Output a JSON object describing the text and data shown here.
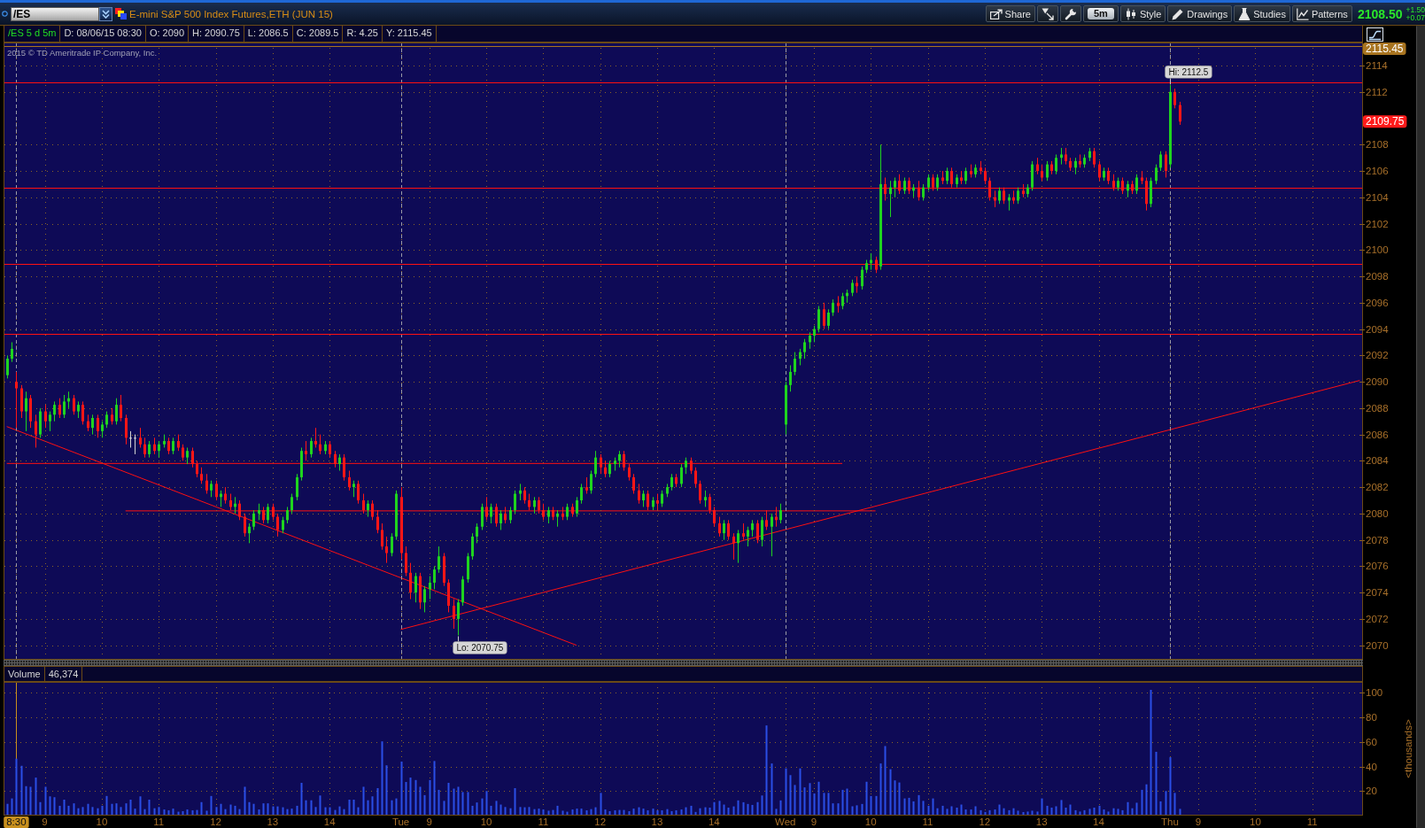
{
  "title_bar": {
    "symbol": "/ES",
    "description": "E-mini S&P 500 Index Futures,ETH (JUN 15)",
    "toolbar": [
      {
        "kind": "share",
        "label": "Share"
      },
      {
        "kind": "arrow"
      },
      {
        "kind": "wrench"
      },
      {
        "kind": "period",
        "label": "5m"
      },
      {
        "kind": "style",
        "label": "Style"
      },
      {
        "kind": "drawings",
        "label": "Drawings"
      },
      {
        "kind": "studies",
        "label": "Studies"
      },
      {
        "kind": "patterns",
        "label": "Patterns"
      }
    ],
    "last_price": "2108.50",
    "net_change": "+1.50",
    "percent_change": "+0.07"
  },
  "price_pane": {
    "study": "/ES 5 d 5m",
    "readouts": [
      "D: 08/06/15 08:30",
      "O: 2090",
      "H: 2090.75",
      "L: 2086.5",
      "C: 2089.5",
      "R: 4.25",
      "Y: 2115.45"
    ],
    "copyright": "2015 © TD Ameritrade IP Company, Inc.",
    "chart_data": [
      {
        "type": "candlestick",
        "ylim": [
          2068.9,
          2115.75
        ],
        "yticks": [
          2070,
          2072,
          2074,
          2076,
          2078,
          2080,
          2082,
          2084,
          2086,
          2088,
          2090,
          2092,
          2094,
          2096,
          2098,
          2100,
          2102,
          2104,
          2106,
          2108,
          2112,
          2114
        ],
        "tick_labels": "y",
        "grid": true,
        "ohlc": [
          [
            2090.5,
            2092,
            2090.25,
            2091.75
          ],
          [
            2091.75,
            2093,
            2091.5,
            2092.5
          ],
          [
            2090,
            2090.75,
            2086.5,
            2089.5
          ],
          [
            2089.5,
            2089.75,
            2087.25,
            2087.75
          ],
          [
            2087.75,
            2089.25,
            2086.25,
            2088.75
          ],
          [
            2088.75,
            2089,
            2086.5,
            2087
          ],
          [
            2087,
            2087.5,
            2085,
            2086
          ],
          [
            2086,
            2088,
            2085.75,
            2087.75
          ],
          [
            2087.75,
            2088.25,
            2086.5,
            2087
          ],
          [
            2087,
            2087.75,
            2086.25,
            2087.5
          ],
          [
            2087.5,
            2088.5,
            2087,
            2088.25
          ],
          [
            2088.25,
            2088.75,
            2087.25,
            2087.5
          ],
          [
            2087.5,
            2089,
            2087.25,
            2088.5
          ],
          [
            2088.5,
            2089.25,
            2088,
            2088.75
          ],
          [
            2088.75,
            2089,
            2087.5,
            2087.75
          ],
          [
            2087.75,
            2088.5,
            2087.25,
            2088.25
          ],
          [
            2088.25,
            2088.5,
            2086.75,
            2087
          ],
          [
            2087,
            2087.5,
            2086.25,
            2086.5
          ],
          [
            2086.5,
            2087.5,
            2086,
            2087.25
          ],
          [
            2087.25,
            2087.5,
            2085.75,
            2086.25
          ],
          [
            2086.25,
            2087,
            2085.75,
            2086.75
          ],
          [
            2086.75,
            2087.75,
            2086.5,
            2087.5
          ],
          [
            2087.5,
            2088,
            2086.75,
            2087
          ],
          [
            2087,
            2088.75,
            2086.75,
            2088.25
          ],
          [
            2088.25,
            2089,
            2087,
            2087.25
          ],
          [
            2087.25,
            2087.5,
            2085.25,
            2085.75
          ],
          [
            2085.75,
            2086.25,
            2085,
            2085.75
          ],
          [
            2085.75,
            2086,
            2084.5,
            2085.75
          ],
          [
            2085.75,
            2086.5,
            2085,
            2085.25
          ],
          [
            2085.25,
            2085.75,
            2084.25,
            2084.5
          ],
          [
            2084.5,
            2085.5,
            2084.25,
            2085.25
          ],
          [
            2085.25,
            2085.75,
            2084.5,
            2084.75
          ],
          [
            2084.75,
            2085.5,
            2084.25,
            2085.25
          ],
          [
            2085.25,
            2086,
            2085,
            2085.5
          ],
          [
            2085.5,
            2085.75,
            2084.5,
            2084.75
          ],
          [
            2084.75,
            2085.75,
            2084.5,
            2085.5
          ],
          [
            2085.5,
            2086,
            2084.75,
            2085
          ],
          [
            2085,
            2085.25,
            2084,
            2084.25
          ],
          [
            2084.25,
            2085,
            2083.75,
            2084.75
          ],
          [
            2084.75,
            2085,
            2083.5,
            2083.75
          ],
          [
            2083.75,
            2084,
            2082.75,
            2083
          ],
          [
            2083,
            2083.5,
            2082.25,
            2082.5
          ],
          [
            2082.5,
            2083,
            2081.5,
            2081.75
          ],
          [
            2081.75,
            2082.5,
            2081.25,
            2082.25
          ],
          [
            2082.25,
            2082.5,
            2081,
            2081.25
          ],
          [
            2081.25,
            2081.75,
            2080.5,
            2081.5
          ],
          [
            2081.5,
            2082,
            2080.75,
            2081
          ],
          [
            2081,
            2081.5,
            2080.25,
            2080.5
          ],
          [
            2080.5,
            2081.25,
            2080,
            2080.75
          ],
          [
            2080.75,
            2081,
            2079.5,
            2079.75
          ],
          [
            2079.75,
            2080,
            2078.25,
            2078.5
          ],
          [
            2078.5,
            2079.25,
            2077.75,
            2079
          ],
          [
            2079,
            2080.25,
            2078.75,
            2080
          ],
          [
            2080,
            2080.75,
            2079.5,
            2080.25
          ],
          [
            2080.25,
            2080.5,
            2079.25,
            2079.5
          ],
          [
            2079.5,
            2080.75,
            2079.25,
            2080.5
          ],
          [
            2080.5,
            2080.75,
            2079.5,
            2079.75
          ],
          [
            2079.75,
            2080,
            2078.25,
            2078.75
          ],
          [
            2078.75,
            2079.75,
            2078.5,
            2079.5
          ],
          [
            2079.5,
            2080.5,
            2079.25,
            2080.25
          ],
          [
            2080.25,
            2081.5,
            2080,
            2081.25
          ],
          [
            2081.25,
            2083,
            2081,
            2082.75
          ],
          [
            2082.75,
            2085,
            2082.5,
            2084.75
          ],
          [
            2084.75,
            2085.5,
            2084,
            2084.5
          ],
          [
            2084.5,
            2085.75,
            2084.25,
            2085.5
          ],
          [
            2085.5,
            2086.5,
            2085,
            2085.25
          ],
          [
            2085.25,
            2086,
            2084.5,
            2084.75
          ],
          [
            2084.75,
            2085.5,
            2084.5,
            2085.25
          ],
          [
            2085.25,
            2085.5,
            2084.25,
            2084.5
          ],
          [
            2084.5,
            2084.75,
            2083.5,
            2083.75
          ],
          [
            2083.75,
            2084.5,
            2083.25,
            2084.25
          ],
          [
            2084.25,
            2084.5,
            2082.5,
            2082.75
          ],
          [
            2082.75,
            2083.25,
            2081.75,
            2082
          ],
          [
            2082,
            2082.5,
            2081.25,
            2082.25
          ],
          [
            2082.25,
            2082.5,
            2080.75,
            2081
          ],
          [
            2081,
            2081.5,
            2080,
            2080.25
          ],
          [
            2080.25,
            2081,
            2079.75,
            2080.75
          ],
          [
            2080.75,
            2081,
            2079.5,
            2079.75
          ],
          [
            2079.75,
            2080.25,
            2078.5,
            2078.75
          ],
          [
            2078.75,
            2079.25,
            2077.25,
            2077.5
          ],
          [
            2077.5,
            2078.25,
            2076.25,
            2077
          ],
          [
            2077,
            2078.5,
            2076.75,
            2078.25
          ],
          [
            2078.25,
            2081.75,
            2078,
            2081.5
          ],
          [
            2081.25,
            2082,
            2076.5,
            2077
          ],
          [
            2077,
            2077.5,
            2075.25,
            2075.5
          ],
          [
            2075.5,
            2076.25,
            2073.5,
            2074
          ],
          [
            2074,
            2075.5,
            2073.25,
            2075.25
          ],
          [
            2075.25,
            2075.5,
            2072.75,
            2073.25
          ],
          [
            2073.25,
            2074.5,
            2072.5,
            2074.25
          ],
          [
            2074.25,
            2075.25,
            2073.5,
            2074.75
          ],
          [
            2074.75,
            2076,
            2074.25,
            2075.75
          ],
          [
            2075.75,
            2077.5,
            2075.5,
            2076.75
          ],
          [
            2076.75,
            2077,
            2074.5,
            2074.75
          ],
          [
            2074.75,
            2075,
            2072.5,
            2073
          ],
          [
            2073,
            2073.5,
            2071.25,
            2072
          ],
          [
            2072,
            2073.5,
            2070.75,
            2073.25
          ],
          [
            2073.25,
            2075.25,
            2073,
            2075
          ],
          [
            2075,
            2077,
            2074.75,
            2076.75
          ],
          [
            2076.75,
            2078.5,
            2076.5,
            2078.25
          ],
          [
            2078.25,
            2079.25,
            2077.75,
            2079
          ],
          [
            2079,
            2080.75,
            2078.75,
            2080.5
          ],
          [
            2080.5,
            2081.25,
            2079.5,
            2079.75
          ],
          [
            2079.75,
            2080.75,
            2079.25,
            2080.5
          ],
          [
            2080.5,
            2080.75,
            2079,
            2079.25
          ],
          [
            2079.25,
            2080.25,
            2078.75,
            2080
          ],
          [
            2080,
            2080.5,
            2079.25,
            2079.5
          ],
          [
            2079.5,
            2080.5,
            2079.25,
            2080.25
          ],
          [
            2080.25,
            2081.75,
            2080,
            2081.5
          ],
          [
            2081.5,
            2082.25,
            2081,
            2081.75
          ],
          [
            2081.75,
            2082,
            2080.75,
            2081
          ],
          [
            2081,
            2081.5,
            2080.25,
            2080.5
          ],
          [
            2080.5,
            2081.25,
            2080,
            2081
          ],
          [
            2081,
            2081.25,
            2080,
            2080.25
          ],
          [
            2080.25,
            2080.75,
            2079.5,
            2079.75
          ],
          [
            2079.75,
            2080.5,
            2079.25,
            2080.25
          ],
          [
            2080.25,
            2080.5,
            2079.5,
            2079.75
          ],
          [
            2079.75,
            2080.25,
            2079,
            2080
          ],
          [
            2080,
            2080.5,
            2079.5,
            2079.75
          ],
          [
            2079.75,
            2080.75,
            2079.5,
            2080.5
          ],
          [
            2080.5,
            2080.75,
            2079.75,
            2080
          ],
          [
            2080,
            2081.25,
            2079.75,
            2081
          ],
          [
            2081,
            2082.25,
            2080.75,
            2082
          ],
          [
            2082,
            2082.75,
            2081.5,
            2081.75
          ],
          [
            2081.75,
            2083.25,
            2081.5,
            2083
          ],
          [
            2083,
            2084.75,
            2082.75,
            2084.25
          ],
          [
            2084.25,
            2084.5,
            2083,
            2083.5
          ],
          [
            2083.5,
            2084,
            2082.75,
            2083
          ],
          [
            2083,
            2084,
            2082.75,
            2083.75
          ],
          [
            2083.75,
            2084.25,
            2083.25,
            2084
          ],
          [
            2084,
            2084.75,
            2083.5,
            2084.5
          ],
          [
            2084.5,
            2084.75,
            2083.25,
            2083.5
          ],
          [
            2083.5,
            2083.75,
            2082.5,
            2082.75
          ],
          [
            2082.75,
            2083,
            2081.5,
            2081.75
          ],
          [
            2081.75,
            2082.25,
            2080.75,
            2081
          ],
          [
            2081,
            2081.75,
            2080.5,
            2081.5
          ],
          [
            2081.5,
            2081.75,
            2080.25,
            2080.5
          ],
          [
            2080.5,
            2081.25,
            2080.25,
            2081
          ],
          [
            2081,
            2081.5,
            2080.25,
            2080.75
          ],
          [
            2080.75,
            2081.75,
            2080.5,
            2081.5
          ],
          [
            2081.5,
            2082.25,
            2081.25,
            2082
          ],
          [
            2082,
            2083,
            2081.75,
            2082.75
          ],
          [
            2082.75,
            2083,
            2082,
            2082.25
          ],
          [
            2082.25,
            2083.75,
            2082,
            2083.5
          ],
          [
            2083.5,
            2084.25,
            2083,
            2084
          ],
          [
            2084,
            2084.25,
            2083,
            2083.25
          ],
          [
            2083.25,
            2083.5,
            2082,
            2082.25
          ],
          [
            2082.25,
            2082.5,
            2080.75,
            2081
          ],
          [
            2081,
            2081.75,
            2080.5,
            2081.25
          ],
          [
            2081.25,
            2081.5,
            2080,
            2080.25
          ],
          [
            2080.25,
            2080.5,
            2079,
            2079.25
          ],
          [
            2079.25,
            2079.75,
            2078.25,
            2078.5
          ],
          [
            2078.5,
            2079.5,
            2078,
            2079.25
          ],
          [
            2079.25,
            2079.5,
            2078,
            2078.25
          ],
          [
            2078.25,
            2078.5,
            2076.5,
            2077.75
          ],
          [
            2077.75,
            2078.75,
            2076.25,
            2078.5
          ],
          [
            2078.5,
            2079.25,
            2078,
            2078.25
          ],
          [
            2078.25,
            2079,
            2077.5,
            2078.75
          ],
          [
            2078.75,
            2079.5,
            2078.25,
            2079.25
          ],
          [
            2079.25,
            2079.5,
            2077.75,
            2078
          ],
          [
            2078,
            2079.75,
            2077.5,
            2079.5
          ],
          [
            2079.5,
            2080.25,
            2078.75,
            2079
          ],
          [
            2079,
            2080,
            2076.75,
            2079.75
          ],
          [
            2079.75,
            2080.5,
            2079,
            2079.5
          ],
          [
            2079.5,
            2080.75,
            2079.25,
            2080.25
          ],
          [
            2086.75,
            2090,
            2086,
            2089.75
          ],
          [
            2089.75,
            2091.25,
            2089.25,
            2090.75
          ],
          [
            2090.75,
            2092.25,
            2090.5,
            2091.75
          ],
          [
            2091.75,
            2092.5,
            2091.25,
            2092.25
          ],
          [
            2092.25,
            2093.25,
            2091.75,
            2093
          ],
          [
            2093,
            2093.75,
            2092.5,
            2093.5
          ],
          [
            2093.5,
            2094.25,
            2093,
            2094
          ],
          [
            2094,
            2095.75,
            2093.75,
            2095.5
          ],
          [
            2095.5,
            2096,
            2094,
            2094.25
          ],
          [
            2094.25,
            2095.5,
            2094,
            2095.25
          ],
          [
            2095.25,
            2096.25,
            2095,
            2096
          ],
          [
            2096,
            2096.5,
            2095.25,
            2095.75
          ],
          [
            2095.75,
            2096.75,
            2095.5,
            2096.5
          ],
          [
            2096.5,
            2097,
            2096,
            2096.75
          ],
          [
            2096.75,
            2097.75,
            2096.5,
            2097.5
          ],
          [
            2097.5,
            2098,
            2096.75,
            2097.25
          ],
          [
            2097.25,
            2098.75,
            2097,
            2098.5
          ],
          [
            2098.5,
            2099.25,
            2098.25,
            2099
          ],
          [
            2099,
            2099.75,
            2098.5,
            2099.25
          ],
          [
            2099.25,
            2099.5,
            2098.25,
            2098.5
          ],
          [
            2098.75,
            2108,
            2098.5,
            2105
          ],
          [
            2105,
            2105.5,
            2103.75,
            2104.25
          ],
          [
            2104.25,
            2105.25,
            2102.5,
            2104.75
          ],
          [
            2104.75,
            2105.5,
            2104,
            2105.25
          ],
          [
            2105.25,
            2105.75,
            2104.25,
            2104.5
          ],
          [
            2104.5,
            2105.5,
            2104.25,
            2105.25
          ],
          [
            2105.25,
            2105.5,
            2104.25,
            2104.5
          ],
          [
            2104.5,
            2105,
            2104,
            2104.75
          ],
          [
            2104.75,
            2105.25,
            2103.75,
            2104
          ],
          [
            2104,
            2105,
            2103.75,
            2104.75
          ],
          [
            2104.75,
            2105.75,
            2104.5,
            2105.5
          ],
          [
            2105.5,
            2105.75,
            2104.5,
            2104.75
          ],
          [
            2104.75,
            2105.75,
            2104.5,
            2105.5
          ],
          [
            2105.5,
            2106,
            2105,
            2105.25
          ],
          [
            2105.25,
            2106.25,
            2105,
            2106
          ],
          [
            2106,
            2106.25,
            2104.75,
            2105
          ],
          [
            2105,
            2105.75,
            2104.75,
            2105.5
          ],
          [
            2105.5,
            2106,
            2105,
            2105.25
          ],
          [
            2105.25,
            2106.25,
            2105,
            2106
          ],
          [
            2106,
            2106.5,
            2105.5,
            2105.75
          ],
          [
            2105.75,
            2106.5,
            2105.5,
            2106.25
          ],
          [
            2106.25,
            2106.75,
            2105.75,
            2106
          ],
          [
            2106,
            2106.25,
            2105,
            2105.25
          ],
          [
            2105.25,
            2105.5,
            2103.75,
            2104
          ],
          [
            2104,
            2104.5,
            2103.25,
            2103.75
          ],
          [
            2103.75,
            2104.75,
            2103.5,
            2104.5
          ],
          [
            2104.5,
            2104.75,
            2103.5,
            2103.75
          ],
          [
            2103.75,
            2104.25,
            2103,
            2104
          ],
          [
            2104,
            2104.5,
            2103.5,
            2103.75
          ],
          [
            2103.75,
            2104.75,
            2103.5,
            2104.5
          ],
          [
            2104.5,
            2105,
            2104,
            2104.25
          ],
          [
            2104.25,
            2105,
            2104,
            2104.75
          ],
          [
            2104.75,
            2106.75,
            2104.5,
            2106.5
          ],
          [
            2106.5,
            2107,
            2105.75,
            2106
          ],
          [
            2106,
            2106.5,
            2105.25,
            2105.5
          ],
          [
            2105.5,
            2106.75,
            2105.25,
            2106.5
          ],
          [
            2106.5,
            2106.75,
            2105.75,
            2106
          ],
          [
            2106,
            2107.25,
            2105.75,
            2107
          ],
          [
            2107,
            2107.75,
            2106.5,
            2107.25
          ],
          [
            2107.25,
            2107.75,
            2106.5,
            2106.75
          ],
          [
            2106.75,
            2107,
            2106,
            2106.25
          ],
          [
            2106.25,
            2107,
            2105.75,
            2106.75
          ],
          [
            2106.75,
            2107.25,
            2106.25,
            2106.5
          ],
          [
            2106.5,
            2107.25,
            2106.25,
            2107
          ],
          [
            2107,
            2107.75,
            2106.75,
            2107.5
          ],
          [
            2107.5,
            2107.75,
            2106.25,
            2106.5
          ],
          [
            2106.5,
            2106.75,
            2105.25,
            2105.5
          ],
          [
            2105.5,
            2106.25,
            2105.25,
            2106
          ],
          [
            2106,
            2106.25,
            2105,
            2105.25
          ],
          [
            2105.25,
            2105.75,
            2104.5,
            2104.75
          ],
          [
            2104.75,
            2105.5,
            2104.5,
            2105.25
          ],
          [
            2105.25,
            2105.5,
            2104.25,
            2104.5
          ],
          [
            2104.5,
            2105.25,
            2104,
            2105
          ],
          [
            2105,
            2105.25,
            2104.25,
            2104.5
          ],
          [
            2104.5,
            2105.75,
            2104.25,
            2105.5
          ],
          [
            2105.5,
            2106,
            2105,
            2105.25
          ],
          [
            2105.25,
            2105.5,
            2103,
            2103.5
          ],
          [
            2103.5,
            2105.5,
            2103.25,
            2105.25
          ],
          [
            2105.25,
            2106.5,
            2105,
            2106.25
          ],
          [
            2106.25,
            2107.5,
            2106,
            2107.25
          ],
          [
            2107.25,
            2107.5,
            2105.5,
            2106
          ],
          [
            2106.5,
            2112.5,
            2106.25,
            2112
          ],
          [
            2112,
            2112.25,
            2110.75,
            2111
          ],
          [
            2111,
            2111.25,
            2109.5,
            2109.75
          ],
          null,
          null,
          null,
          null,
          null,
          null,
          null,
          null,
          null,
          null,
          null,
          null,
          null,
          null,
          null,
          null,
          null,
          null,
          null,
          null,
          null,
          null,
          null,
          null,
          null,
          null,
          null,
          null,
          null,
          null,
          null,
          null,
          null,
          null,
          null,
          null,
          null,
          null
        ],
        "ref_lines": [
          {
            "axis": "y",
            "value": 2115.45,
            "label": "2115.45",
            "color": "#a87420",
            "line_style": "solid"
          },
          {
            "axis": "y",
            "value": 2112.7,
            "color": "#ff1010",
            "line_style": "solid"
          },
          {
            "axis": "y",
            "value": 2104.7,
            "color": "#ff1010",
            "line_style": "solid"
          },
          {
            "axis": "y",
            "value": 2098.95,
            "color": "#ff1010",
            "line_style": "solid"
          },
          {
            "axis": "y",
            "value": 2093.65,
            "color": "#ff1010",
            "line_style": "solid"
          }
        ],
        "annotations": [
          "Hi: 2112.5",
          "Lo: 2070.75",
          "2109.75"
        ]
      }
    ]
  },
  "volume_pane": {
    "study": "Volume",
    "readout": "46,374",
    "chart_data": [
      {
        "type": "bar",
        "color": "#2a4ee6",
        "ylim": [
          0,
          109
        ],
        "yticks": [
          20,
          40,
          60,
          80,
          100
        ],
        "ylabel": "<thousands>",
        "grid": true,
        "categories": [
          null,
          null,
          "8:30",
          null,
          null,
          null,
          null,
          null,
          "9",
          null,
          null,
          null,
          null,
          null,
          null,
          null,
          null,
          null,
          null,
          null,
          "10",
          null,
          null,
          null,
          null,
          null,
          null,
          null,
          null,
          null,
          null,
          null,
          "11",
          null,
          null,
          null,
          null,
          null,
          null,
          null,
          null,
          null,
          null,
          null,
          "12",
          null,
          null,
          null,
          null,
          null,
          null,
          null,
          null,
          null,
          null,
          null,
          "13",
          null,
          null,
          null,
          null,
          null,
          null,
          null,
          null,
          null,
          null,
          null,
          "14",
          null,
          null,
          null,
          null,
          null,
          null,
          null,
          null,
          null,
          null,
          null,
          null,
          null,
          null,
          "Tue",
          null,
          null,
          null,
          null,
          null,
          "9",
          null,
          null,
          null,
          null,
          null,
          null,
          null,
          null,
          null,
          null,
          null,
          "10",
          null,
          null,
          null,
          null,
          null,
          null,
          null,
          null,
          null,
          null,
          null,
          "11",
          null,
          null,
          null,
          null,
          null,
          null,
          null,
          null,
          null,
          null,
          null,
          "12",
          null,
          null,
          null,
          null,
          null,
          null,
          null,
          null,
          null,
          null,
          null,
          "13",
          null,
          null,
          null,
          null,
          null,
          null,
          null,
          null,
          null,
          null,
          null,
          "14",
          null,
          null,
          null,
          null,
          null,
          null,
          null,
          null,
          null,
          null,
          null,
          null,
          null,
          null,
          "Wed",
          null,
          null,
          null,
          null,
          null,
          "9",
          null,
          null,
          null,
          null,
          null,
          null,
          null,
          null,
          null,
          null,
          null,
          "10",
          null,
          null,
          null,
          null,
          null,
          null,
          null,
          null,
          null,
          null,
          null,
          "11",
          null,
          null,
          null,
          null,
          null,
          null,
          null,
          null,
          null,
          null,
          null,
          "12",
          null,
          null,
          null,
          null,
          null,
          null,
          null,
          null,
          null,
          null,
          null,
          "13",
          null,
          null,
          null,
          null,
          null,
          null,
          null,
          null,
          null,
          null,
          null,
          "14",
          null,
          null,
          null,
          null,
          null,
          null,
          null,
          null,
          null,
          null,
          null,
          null,
          null,
          null,
          "Thu",
          null,
          null,
          null,
          null,
          null,
          "9",
          null,
          null,
          null,
          null,
          null,
          null,
          null,
          null,
          null,
          null,
          null,
          "10",
          null,
          null,
          null,
          null,
          null,
          null,
          null,
          null,
          null,
          null,
          null,
          "11",
          null,
          null,
          null,
          null,
          null,
          null,
          null,
          null,
          null,
          null
        ],
        "values": [
          9.6,
          14,
          46.4,
          40.6,
          24,
          23.5,
          31,
          11,
          23.5,
          15.7,
          15,
          8,
          13,
          8,
          10,
          6,
          7,
          9.6,
          7,
          6,
          8,
          16,
          9.6,
          10,
          7,
          10,
          13,
          5.7,
          15.7,
          5.3,
          13,
          6,
          7,
          5,
          4.3,
          5.7,
          3.2,
          3.6,
          5,
          4.3,
          4.6,
          11,
          4,
          16,
          7,
          9.6,
          5.3,
          9,
          8,
          5.3,
          23.5,
          11,
          9.6,
          5,
          10,
          10,
          7.5,
          7.5,
          6.8,
          5.3,
          5.7,
          8,
          26.7,
          12.5,
          12.5,
          7,
          16.4,
          6.8,
          6.8,
          4.6,
          7.5,
          5.3,
          13,
          13,
          6.8,
          23.5,
          12.5,
          15.7,
          22.4,
          60.5,
          41,
          12.5,
          14,
          44,
          27.4,
          31,
          29,
          23.5,
          16.7,
          29,
          44.5,
          21,
          12,
          26.7,
          22,
          23.5,
          19.2,
          19.2,
          8,
          10.7,
          14,
          20,
          8,
          12,
          9,
          7,
          6,
          22.4,
          7,
          6.8,
          7,
          5.3,
          5.7,
          5,
          4,
          4.6,
          8,
          4,
          3.2,
          5,
          5.7,
          5.7,
          4.3,
          5.3,
          6.8,
          18.5,
          5,
          3.6,
          4.3,
          4.6,
          4.6,
          3.6,
          5.7,
          6.8,
          5.7,
          4.3,
          5.7,
          4.3,
          4.3,
          5.3,
          3.6,
          4.3,
          5,
          6.8,
          8,
          3,
          6,
          6.8,
          6.5,
          11,
          12,
          9,
          6.5,
          7.5,
          12.4,
          10.9,
          9.5,
          8.7,
          11,
          16.4,
          73.5,
          42.5,
          5.5,
          12.4,
          38.5,
          33,
          25,
          38.5,
          23,
          26.5,
          18,
          27.6,
          18.5,
          18.5,
          10,
          10,
          21,
          22,
          7.6,
          8.4,
          9.5,
          27.6,
          16,
          16,
          42.5,
          56.7,
          37.8,
          28.7,
          27,
          14,
          14.5,
          11.6,
          16.7,
          12,
          8,
          14,
          6,
          8,
          5.5,
          7.6,
          6.5,
          9,
          5,
          5,
          7.6,
          4.4,
          3,
          4.4,
          5,
          9,
          6,
          4.4,
          6,
          4,
          2.9,
          3.3,
          4,
          3.3,
          14,
          8,
          6.5,
          7.6,
          12.7,
          6.5,
          9,
          4.4,
          3.3,
          4.4,
          5.5,
          6.5,
          8,
          5,
          3.3,
          6,
          5.5,
          4.4,
          11,
          6,
          10.5,
          21,
          25.5,
          102.5,
          52,
          11.6,
          20,
          47.6,
          18.5,
          5.5,
          null,
          null,
          null,
          null,
          null,
          null,
          null,
          null,
          null,
          null,
          null,
          null,
          null,
          null,
          null,
          null,
          null,
          null,
          null,
          null,
          null,
          null,
          null,
          null,
          null,
          null,
          null,
          null,
          null,
          null,
          null,
          null,
          null,
          null,
          null,
          null,
          null,
          null
        ],
        "ref_lines": [
          {
            "axis": "x",
            "value": "8:30",
            "color": "#c8901e",
            "line_style": "solid"
          }
        ]
      }
    ]
  }
}
